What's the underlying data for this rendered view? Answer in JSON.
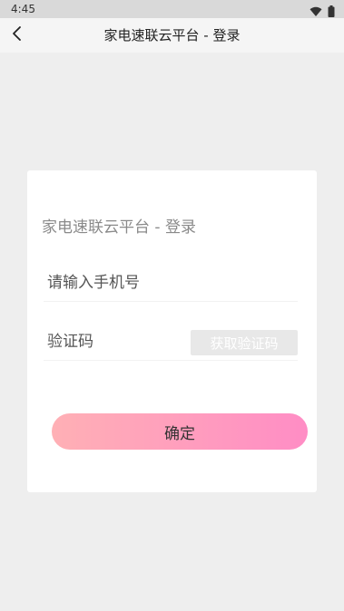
{
  "status_bar": {
    "time": "4:45",
    "icons": [
      "wifi-icon",
      "battery-icon"
    ]
  },
  "app_bar": {
    "back_icon": "back-arrow-icon",
    "title": "家电速联云平台 - 登录"
  },
  "login_card": {
    "title": "家电速联云平台 - 登录",
    "phone_placeholder": "请输入手机号",
    "code_placeholder": "验证码",
    "get_code_label": "获取验证码",
    "confirm_label": "确定"
  },
  "colors": {
    "background": "#eeeeee",
    "status_bar": "#d9d9d9",
    "app_bar": "#f5f5f5",
    "card": "#ffffff",
    "button_gradient_start": "#ffb0b5",
    "button_gradient_end": "#ff8dc5",
    "get_code_button": "#e8e8e8"
  }
}
